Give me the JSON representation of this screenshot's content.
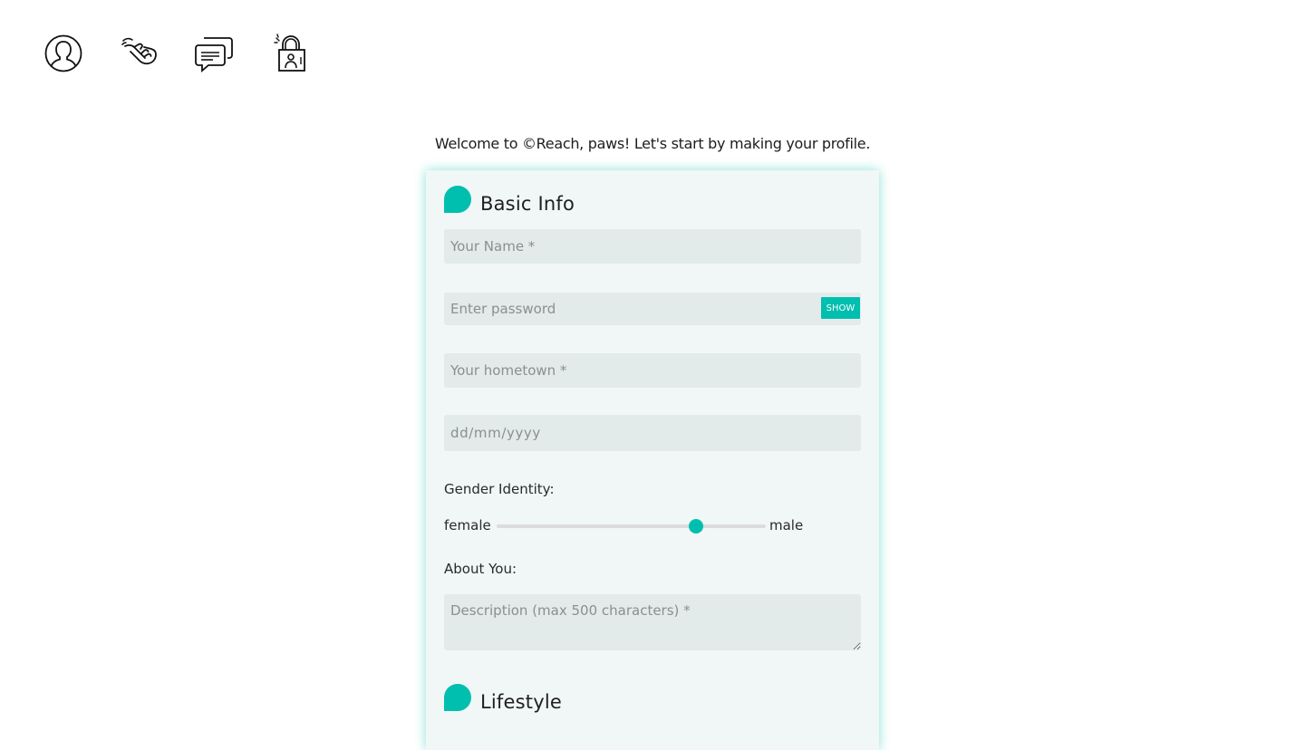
{
  "nav": {
    "items": [
      {
        "icon": "profile-icon"
      },
      {
        "icon": "swipe-hand-icon"
      },
      {
        "icon": "chat-bubbles-icon"
      },
      {
        "icon": "privacy-lock-icon"
      }
    ]
  },
  "welcome": "Welcome to ©Reach, paws! Let's start by making your profile.",
  "accent_color": "#00bfae",
  "basic_info": {
    "title": "Basic Info",
    "name_placeholder": "Your Name *",
    "password_placeholder": "Enter password",
    "show_label": "SHOW",
    "hometown_placeholder": "Your hometown *",
    "date_placeholder": "dd/mm/yyyy",
    "gender_label": "Gender Identity:",
    "gender_left": "female",
    "gender_right": "male",
    "gender_value": 0.74,
    "about_label": "About You:",
    "description_placeholder": "Description (max 500 characters) *"
  },
  "lifestyle": {
    "title": "Lifestyle"
  }
}
